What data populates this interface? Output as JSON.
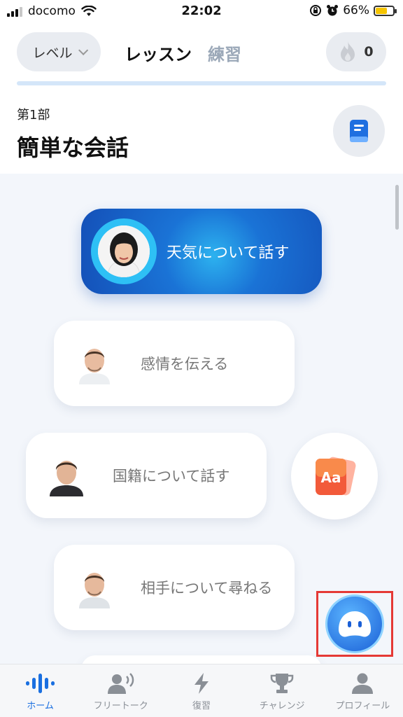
{
  "status_bar": {
    "carrier": "docomo",
    "time": "22:02",
    "battery": "66%",
    "battery_level": 0.66
  },
  "header": {
    "level_label": "レベル",
    "tab_lesson": "レッスン",
    "tab_practice": "練習",
    "streak_count": "0"
  },
  "section": {
    "part_label": "第1部",
    "title": "簡単な会話"
  },
  "lessons": [
    {
      "label": "天気について話す",
      "state": "active"
    },
    {
      "label": "感情を伝える",
      "state": "locked"
    },
    {
      "label": "国籍について話す",
      "state": "locked"
    },
    {
      "label": "相手について尋ねる",
      "state": "locked"
    }
  ],
  "floating": {
    "vocab_label": "Aa"
  },
  "tab_bar": [
    {
      "label": "ホーム",
      "icon": "waveform-icon",
      "active": true
    },
    {
      "label": "フリートーク",
      "icon": "speaking-person-icon",
      "active": false
    },
    {
      "label": "復習",
      "icon": "lightning-icon",
      "active": false
    },
    {
      "label": "チャレンジ",
      "icon": "trophy-icon",
      "active": false
    },
    {
      "label": "プロフィール",
      "icon": "person-icon",
      "active": false
    }
  ],
  "colors": {
    "accent": "#1a6fe0",
    "active_card": "#1a73d6",
    "highlight_frame": "#e53935"
  }
}
